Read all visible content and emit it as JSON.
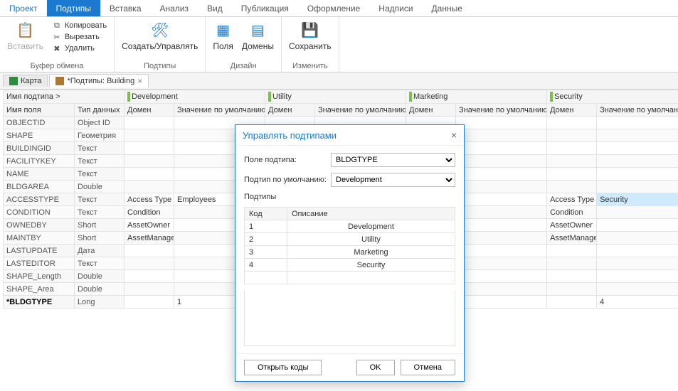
{
  "menu": {
    "items": [
      "Проект",
      "Подтипы",
      "Вставка",
      "Анализ",
      "Вид",
      "Публикация",
      "Оформление",
      "Надписи",
      "Данные"
    ],
    "active_index": 1
  },
  "ribbon": {
    "groups": [
      {
        "title": "Буфер обмена",
        "big": [
          {
            "label": "Вставить",
            "icon": "📋"
          }
        ],
        "small": [
          "Копировать",
          "Вырезать",
          "Удалить"
        ],
        "small_icons": [
          "⧉",
          "✂",
          "✖"
        ]
      },
      {
        "title": "Подтипы",
        "big": [
          {
            "label": "Создать/Управлять",
            "icon": "🛠"
          }
        ]
      },
      {
        "title": "Дизайн",
        "big": [
          {
            "label": "Поля",
            "icon": "▦"
          },
          {
            "label": "Домены",
            "icon": "▤"
          }
        ]
      },
      {
        "title": "Изменить",
        "big": [
          {
            "label": "Сохранить",
            "icon": "💾"
          }
        ]
      }
    ]
  },
  "doc_tabs": [
    {
      "label": "Карта",
      "closable": false,
      "icon_color": "#2e8b3e"
    },
    {
      "label": "*Подтипы: Building",
      "closable": true,
      "icon_color": "#b07730"
    }
  ],
  "grid": {
    "subtype_header_label": "Имя подтипа >",
    "col_field": "Имя поля",
    "col_type": "Тип данных",
    "col_domain": "Домен",
    "col_default": "Значение по умолчанию",
    "subtypes": [
      "Development",
      "Utility",
      "Marketing",
      "Security"
    ],
    "rows": [
      {
        "field": "OBJECTID",
        "type": "Object ID",
        "d1": "",
        "v1": "",
        "d4": "",
        "v4": ""
      },
      {
        "field": "SHAPE",
        "type": "Геометрия",
        "d1": "",
        "v1": "",
        "d4": "",
        "v4": ""
      },
      {
        "field": "BUILDINGID",
        "type": "Текст",
        "d1": "",
        "v1": "",
        "d4": "",
        "v4": ""
      },
      {
        "field": "FACILITYKEY",
        "type": "Текст",
        "d1": "",
        "v1": "",
        "d4": "",
        "v4": ""
      },
      {
        "field": "NAME",
        "type": "Текст",
        "d1": "",
        "v1": "",
        "d4": "",
        "v4": ""
      },
      {
        "field": "BLDGAREA",
        "type": "Double",
        "d1": "",
        "v1": "",
        "d4": "",
        "v4": ""
      },
      {
        "field": "ACCESSTYPE",
        "type": "Текст",
        "d1": "Access Type",
        "v1": "Employees",
        "d4": "Access Type",
        "v4": "Security",
        "v4_sel": true
      },
      {
        "field": "CONDITION",
        "type": "Текст",
        "d1": "Condition",
        "v1": "",
        "d4": "Condition",
        "v4": ""
      },
      {
        "field": "OWNEDBY",
        "type": "Short",
        "d1": "AssetOwner",
        "v1": "",
        "d4": "AssetOwner",
        "v4": ""
      },
      {
        "field": "MAINTBY",
        "type": "Short",
        "d1": "AssetManager",
        "v1": "",
        "d4": "AssetManager",
        "v4": ""
      },
      {
        "field": "LASTUPDATE",
        "type": "Дата",
        "d1": "",
        "v1": "",
        "d4": "",
        "v4": ""
      },
      {
        "field": "LASTEDITOR",
        "type": "Текст",
        "d1": "",
        "v1": "",
        "d4": "",
        "v4": ""
      },
      {
        "field": "SHAPE_Length",
        "type": "Double",
        "d1": "",
        "v1": "",
        "d4": "",
        "v4": ""
      },
      {
        "field": "SHAPE_Area",
        "type": "Double",
        "d1": "",
        "v1": "",
        "d4": "",
        "v4": ""
      },
      {
        "field": "*BLDGTYPE",
        "type": "Long",
        "d1": "",
        "v1": "1",
        "d4": "",
        "v4": "4",
        "bold": true
      }
    ]
  },
  "dialog": {
    "title": "Управлять подтипами",
    "field_label": "Поле подтипа:",
    "field_value": "BLDGTYPE",
    "default_label": "Подтип по умолчанию:",
    "default_value": "Development",
    "subtypes_label": "Подтипы",
    "col_code": "Код",
    "col_desc": "Описание",
    "rows": [
      {
        "code": "1",
        "desc": "Development"
      },
      {
        "code": "2",
        "desc": "Utility"
      },
      {
        "code": "3",
        "desc": "Marketing"
      },
      {
        "code": "4",
        "desc": "Security"
      }
    ],
    "btn_open": "Открыть коды",
    "btn_ok": "OK",
    "btn_cancel": "Отмена"
  }
}
